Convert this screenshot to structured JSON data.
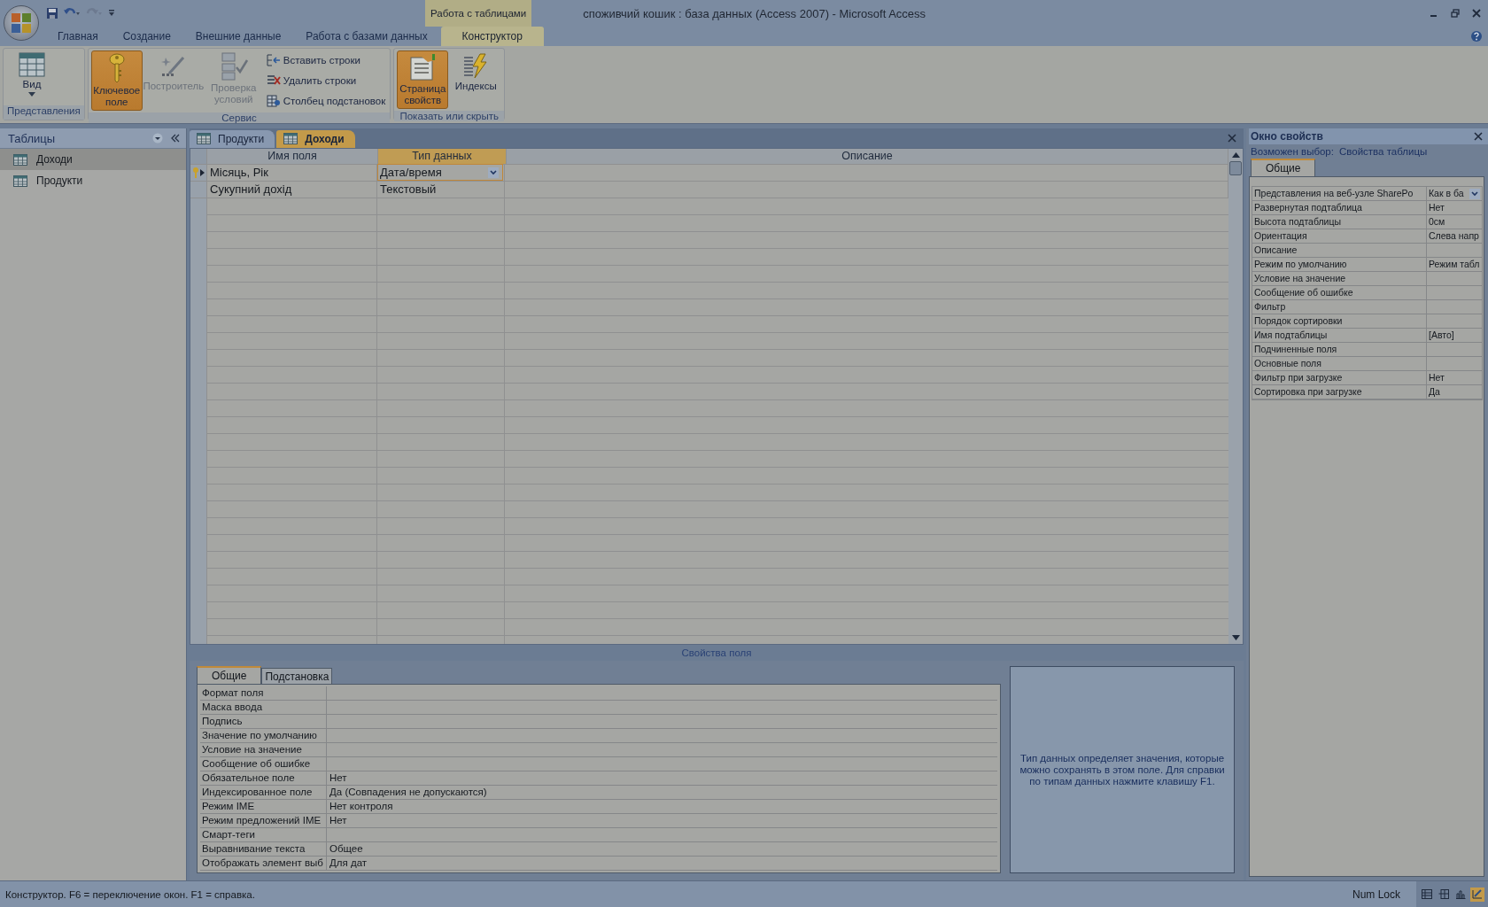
{
  "window": {
    "title": "споживчий кошик : база данных (Access 2007) - Microsoft Access",
    "context_group": "Работа с таблицами"
  },
  "ribbon_tabs": [
    {
      "label": "Главная",
      "selected": false
    },
    {
      "label": "Создание",
      "selected": false
    },
    {
      "label": "Внешние данные",
      "selected": false
    },
    {
      "label": "Работа с базами данных",
      "selected": false
    },
    {
      "label": "Конструктор",
      "selected": true
    }
  ],
  "ribbon_groups": [
    {
      "label": "Представления",
      "buttons": [
        {
          "kind": "table",
          "label": "Вид",
          "dropdown": true,
          "selected": false,
          "disabled": false
        }
      ]
    },
    {
      "label": "Сервис",
      "buttons": [
        {
          "kind": "key",
          "label": "Ключевое поле",
          "selected": true,
          "disabled": false
        },
        {
          "kind": "wand",
          "label": "Построитель",
          "selected": false,
          "disabled": true
        },
        {
          "kind": "check",
          "label": "Проверка условий",
          "selected": false,
          "disabled": true
        }
      ],
      "small_buttons": [
        {
          "kind": "insert",
          "label": "Вставить строки",
          "selected": false,
          "disabled": false
        },
        {
          "kind": "delete",
          "label": "Удалить строки",
          "selected": false,
          "disabled": false
        },
        {
          "kind": "lookup",
          "label": "Столбец  подстановок",
          "selected": false,
          "disabled": false
        }
      ]
    },
    {
      "label": "Показать или скрыть",
      "buttons": [
        {
          "kind": "sheet",
          "label": "Страница свойств",
          "selected": true,
          "disabled": false
        },
        {
          "kind": "bolt",
          "label": "Индексы",
          "selected": false,
          "disabled": false
        }
      ]
    }
  ],
  "nav_pane": {
    "title": "Таблицы",
    "items": [
      {
        "label": "Доходи",
        "selected": true
      },
      {
        "label": "Продукти",
        "selected": false
      }
    ]
  },
  "doc_tabs": [
    {
      "label": "Продукти",
      "selected": false
    },
    {
      "label": "Доходи",
      "selected": true
    }
  ],
  "design_grid": {
    "columns": [
      {
        "label": "Имя поля",
        "selected": false
      },
      {
        "label": "Тип данных",
        "selected": true
      },
      {
        "label": "Описание",
        "selected": false
      }
    ],
    "rows": [
      {
        "field": "Місяць, Рік",
        "type": "Дата/время",
        "current": true,
        "primary_key": true
      },
      {
        "field": "Сукупний дохід",
        "type": "Текстовый",
        "current": false,
        "primary_key": false
      }
    ]
  },
  "field_properties": {
    "title": "Свойства поля",
    "tabs": [
      {
        "label": "Общие",
        "selected": true
      },
      {
        "label": "Подстановка",
        "selected": false
      }
    ],
    "rows": [
      {
        "name": "Формат поля",
        "value": ""
      },
      {
        "name": "Маска ввода",
        "value": ""
      },
      {
        "name": "Подпись",
        "value": ""
      },
      {
        "name": "Значение по умолчанию",
        "value": ""
      },
      {
        "name": "Условие на значение",
        "value": ""
      },
      {
        "name": "Сообщение об ошибке",
        "value": ""
      },
      {
        "name": "Обязательное поле",
        "value": "Нет"
      },
      {
        "name": "Индексированное поле",
        "value": "Да (Совпадения не допускаются)"
      },
      {
        "name": "Режим IME",
        "value": "Нет контроля"
      },
      {
        "name": "Режим предложений IME",
        "value": "Нет"
      },
      {
        "name": "Смарт-теги",
        "value": ""
      },
      {
        "name": "Выравнивание текста",
        "value": "Общее"
      },
      {
        "name": "Отображать элемент выб",
        "value": "Для дат"
      }
    ],
    "help": "Тип данных определяет значения, которые можно сохранять в этом поле.  Для справки по типам данных нажмите клавишу F1."
  },
  "property_sheet": {
    "title": "Окно свойств",
    "selection_label": "Возможен выбор:",
    "selection_type": "Свойства таблицы",
    "tabs": [
      {
        "label": "Общие",
        "selected": true
      }
    ],
    "rows": [
      {
        "name": "Представления на веб-узле SharePo",
        "value": "Как в ба",
        "dropdown": true
      },
      {
        "name": "Развернутая подтаблица",
        "value": "Нет"
      },
      {
        "name": "Высота подтаблицы",
        "value": "0см"
      },
      {
        "name": "Ориентация",
        "value": "Слева напр"
      },
      {
        "name": "Описание",
        "value": ""
      },
      {
        "name": "Режим по умолчанию",
        "value": "Режим табл"
      },
      {
        "name": "Условие на значение",
        "value": ""
      },
      {
        "name": "Сообщение об ошибке",
        "value": ""
      },
      {
        "name": "Фильтр",
        "value": ""
      },
      {
        "name": "Порядок сортировки",
        "value": ""
      },
      {
        "name": "Имя подтаблицы",
        "value": "[Авто]"
      },
      {
        "name": "Подчиненные поля",
        "value": ""
      },
      {
        "name": "Основные поля",
        "value": ""
      },
      {
        "name": "Фильтр при загрузке",
        "value": "Нет"
      },
      {
        "name": "Сортировка при загрузке",
        "value": "Да"
      }
    ]
  },
  "status_bar": {
    "text": "Конструктор.  F6 = переключение окон.  F1 = справка.",
    "indicator": "Num Lock",
    "views": [
      {
        "kind": "datasheet",
        "selected": false
      },
      {
        "kind": "pivot-table",
        "selected": false
      },
      {
        "kind": "pivot-chart",
        "selected": false
      },
      {
        "kind": "design",
        "selected": true
      }
    ]
  }
}
